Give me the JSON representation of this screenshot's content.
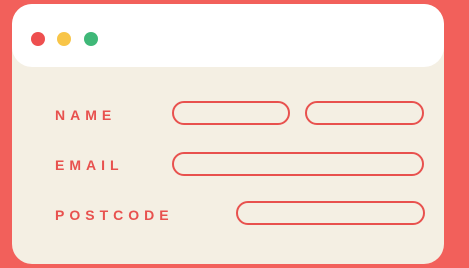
{
  "colors": {
    "background": "#f2605b",
    "window": "#f4efe3",
    "titlebar": "#ffffff",
    "accent": "#e8514e",
    "dot_red": "#ee4f4f",
    "dot_yellow": "#f8c548",
    "dot_green": "#3fb878"
  },
  "window_controls": [
    {
      "name": "close",
      "color": "#ee4f4f"
    },
    {
      "name": "minimize",
      "color": "#f8c548"
    },
    {
      "name": "maximize",
      "color": "#3fb878"
    }
  ],
  "form": {
    "name_label": "NAME",
    "email_label": "EMAIL",
    "postcode_label": "POSTCODE",
    "first_name_value": "",
    "last_name_value": "",
    "email_value": "",
    "postcode_value": ""
  }
}
